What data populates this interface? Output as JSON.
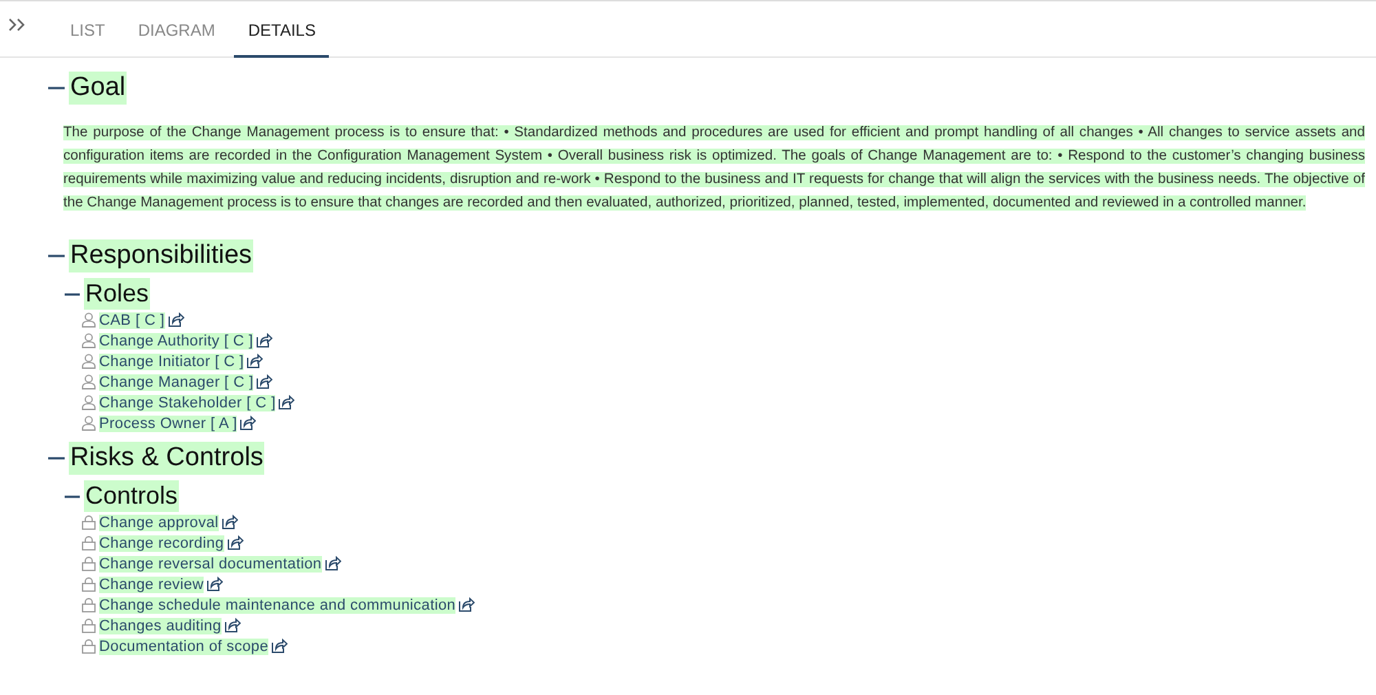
{
  "tabs": [
    {
      "label": "LIST",
      "selected": false
    },
    {
      "label": "DIAGRAM",
      "selected": false
    },
    {
      "label": "DETAILS",
      "selected": true
    }
  ],
  "sections": [
    {
      "title": "Goal",
      "expanded": true,
      "text": "The purpose of the Change Management process is to ensure that: • Standardized methods and procedures are used for efficient and prompt handling of all changes • All changes to service assets and configuration items are recorded in the Configuration Management System • Overall business risk is optimized. The goals of Change Management are to: • Respond to the customer’s changing business requirements while maximizing value and reducing incidents, disruption and re-work • Respond to the business and IT requests for change that will align the services with the business needs. The objective of the Change Management process is to ensure that changes are recorded and then evaluated, authorized, prioritized, planned, tested, implemented, documented and reviewed in a controlled manner."
    },
    {
      "title": "Responsibilities",
      "expanded": true,
      "groups": [
        {
          "title": "Roles",
          "expanded": true,
          "items": [
            {
              "label": "CAB [ C ]",
              "kind": "role"
            },
            {
              "label": "Change Authority [ C ]",
              "kind": "role"
            },
            {
              "label": "Change Initiator [ C ]",
              "kind": "role"
            },
            {
              "label": "Change Manager [ C ]",
              "kind": "role"
            },
            {
              "label": "Change Stakeholder [ C ]",
              "kind": "role"
            },
            {
              "label": "Process Owner [ A ]",
              "kind": "role"
            }
          ]
        }
      ]
    },
    {
      "title": "Risks & Controls",
      "expanded": true,
      "groups": [
        {
          "title": "Controls",
          "expanded": true,
          "items": [
            {
              "label": "Change approval",
              "kind": "control"
            },
            {
              "label": "Change recording",
              "kind": "control"
            },
            {
              "label": "Change reversal documentation",
              "kind": "control"
            },
            {
              "label": "Change review",
              "kind": "control"
            },
            {
              "label": "Change schedule maintenance and communication",
              "kind": "control"
            },
            {
              "label": "Changes auditing",
              "kind": "control"
            },
            {
              "label": "Documentation of scope",
              "kind": "control"
            }
          ]
        }
      ]
    }
  ]
}
